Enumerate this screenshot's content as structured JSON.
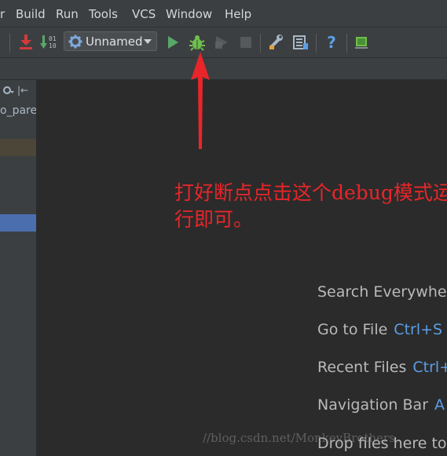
{
  "menubar": {
    "items": [
      "r",
      "Build",
      "Run",
      "Tools",
      "VCS",
      "Window",
      "Help"
    ]
  },
  "toolbar": {
    "run_config_label": "Unnamed",
    "help_label": "?",
    "binary_label": "01\n10"
  },
  "left_panel": {
    "truncated_label": "o_pare"
  },
  "editor": {
    "hints": [
      {
        "label": "Search Everywher",
        "key": ""
      },
      {
        "label": "Go to File",
        "key": "Ctrl+S"
      },
      {
        "label": "Recent Files",
        "key": "Ctrl+"
      },
      {
        "label": "Navigation Bar",
        "key": "A"
      },
      {
        "label": "Drop files here to",
        "key": ""
      }
    ]
  },
  "annotation": {
    "text": "打好断点点击这个debug模式运行即可。",
    "color": "#e8262a"
  },
  "watermark": {
    "text": "//blog.csdn.net/MonkeyBrothers"
  },
  "colors": {
    "run_green": "#59a869",
    "debug_green": "#6fbf4e",
    "selection_blue": "#4b6eaf",
    "hint_key_blue": "#5c9ee6"
  },
  "icons": [
    "build-red-arrow-icon",
    "binary-sort-icon",
    "gear-icon",
    "run-icon",
    "debug-bug-icon",
    "coverage-icon",
    "stop-icon",
    "settings-wrench-icon",
    "project-structure-icon",
    "help-icon",
    "sdk-icon",
    "red-arrow-icon"
  ]
}
